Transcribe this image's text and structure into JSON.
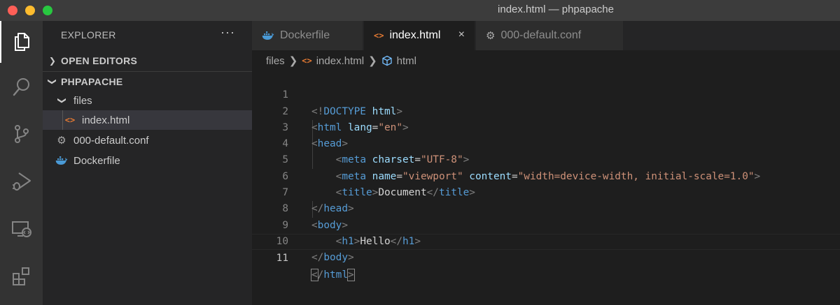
{
  "window": {
    "title": "index.html — phpapache"
  },
  "activity_bar": {
    "items": [
      "explorer",
      "search",
      "source-control",
      "run-debug",
      "remote-explorer",
      "extensions"
    ]
  },
  "sidebar": {
    "header": "EXPLORER",
    "more": "···",
    "open_editors": "OPEN EDITORS",
    "project": "PHPAPACHE",
    "tree": {
      "folder": "files",
      "file_in_folder": "index.html",
      "file2": "000-default.conf",
      "file3": "Dockerfile"
    }
  },
  "tabs": [
    {
      "label": "Dockerfile",
      "icon": "docker-icon",
      "active": false
    },
    {
      "label": "index.html",
      "icon": "html-icon",
      "active": true,
      "close": "×"
    },
    {
      "label": "000-default.conf",
      "icon": "gear-icon",
      "active": false
    }
  ],
  "breadcrumb": {
    "folder": "files",
    "file": "index.html",
    "symbol": "html"
  },
  "editor": {
    "line_numbers": [
      "1",
      "2",
      "3",
      "4",
      "5",
      "6",
      "7",
      "8",
      "9",
      "10",
      "11"
    ],
    "current_line": 11
  },
  "colors": {
    "tag": "#569cd6",
    "attribute": "#9cdcfe",
    "string": "#ce9178",
    "punctuation": "#808080",
    "html_icon": "#e37933",
    "docker_icon": "#4a9ad6"
  }
}
